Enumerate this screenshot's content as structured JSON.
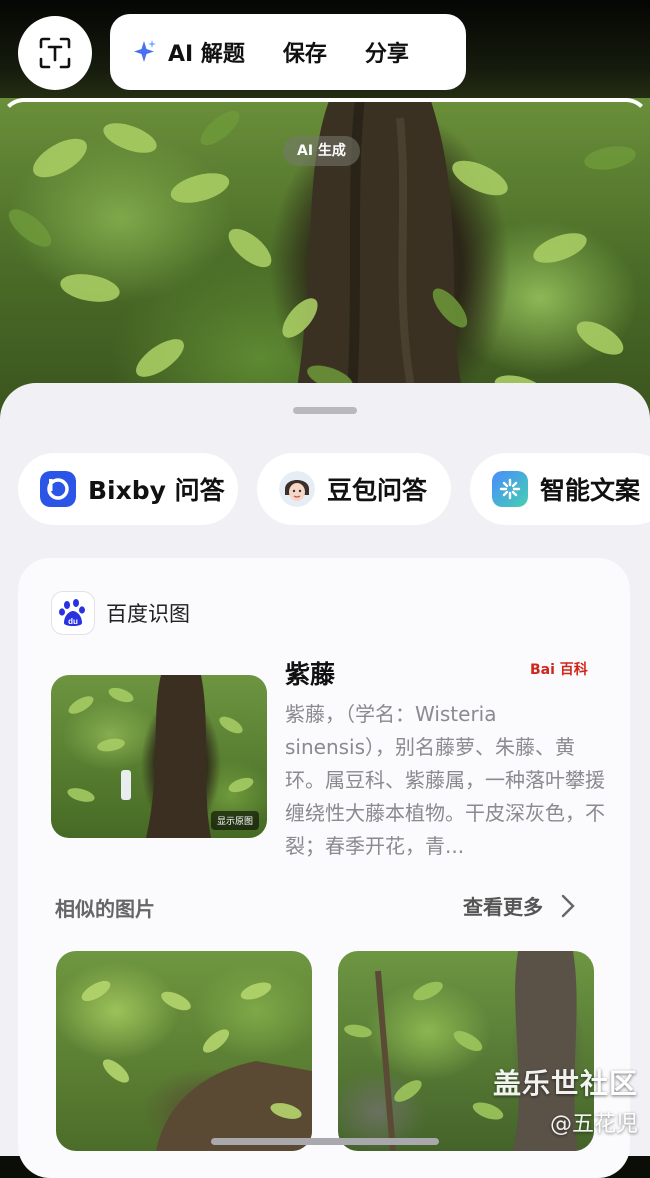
{
  "toolbar": {
    "ai_label": "AI 解题",
    "save_label": "保存",
    "share_label": "分享"
  },
  "photo": {
    "ai_badge": "AI 生成"
  },
  "chips": [
    {
      "label": "Bixby 问答",
      "icon": "bixby-icon"
    },
    {
      "label": "豆包问答",
      "icon": "doubao-avatar-icon"
    },
    {
      "label": "智能文案",
      "icon": "smart-copy-icon"
    }
  ],
  "card": {
    "source": "百度识图",
    "title": "紫藤",
    "baike_label": "Bai 百科",
    "description": "紫藤，（学名：Wisteria sinensis），别名藤萝、朱藤、黄环。属豆科、紫藤属，一种落叶攀援缠绕性大藤本植物。干皮深灰色，不裂；春季开花，青...",
    "show_original": "显示原图",
    "similar_label": "相似的图片",
    "more_label": "查看更多"
  },
  "watermark": {
    "line1": "盖乐世社区",
    "line2": "@五花児"
  },
  "colors": {
    "sheet_bg": "#f1f1f5",
    "card_bg": "#fbfbfd",
    "baike_red": "#d0251b",
    "bixby_blue": "#2b55e6"
  }
}
